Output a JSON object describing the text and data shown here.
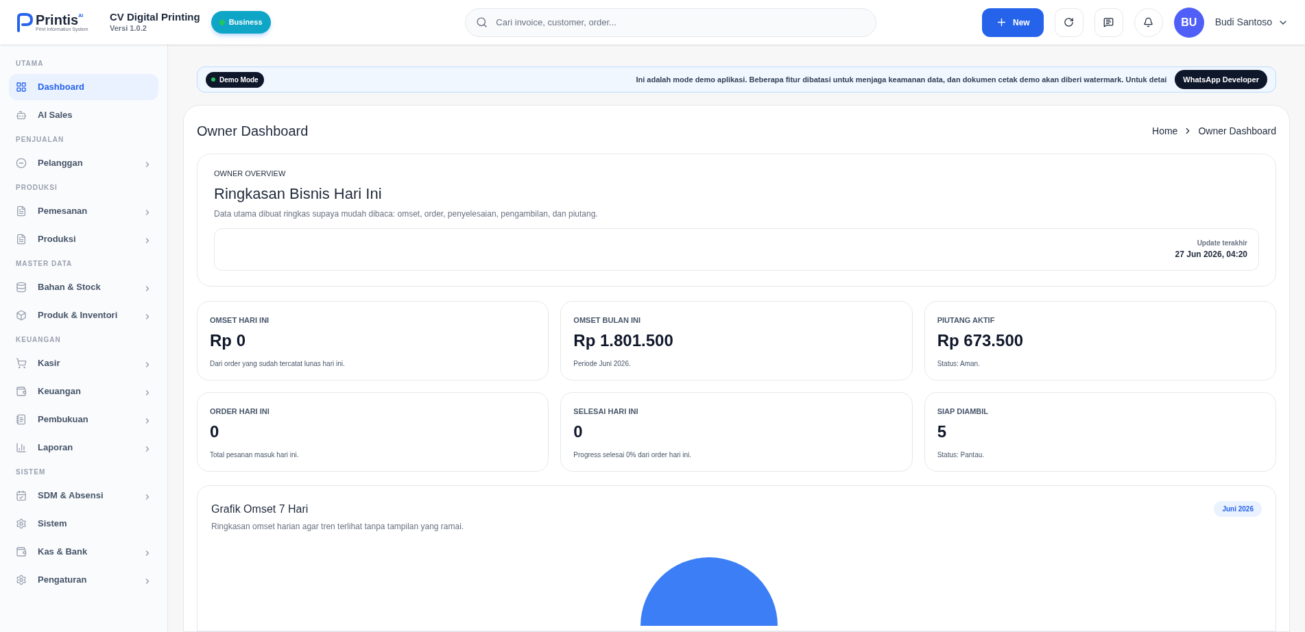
{
  "header": {
    "logo": {
      "name": "Printis",
      "superscript": "AI",
      "tagline": "Print Information System"
    },
    "company": "CV Digital Printing",
    "version": "Versi 1.0.2",
    "plan_badge": "Business",
    "search": {
      "placeholder": "Cari invoice, customer, order..."
    },
    "new_button": "New",
    "user": {
      "initials": "BU",
      "name": "Budi Santoso"
    }
  },
  "sidebar": [
    {
      "title": "UTAMA",
      "items": [
        {
          "label": "Dashboard",
          "selected": true,
          "has_submenu": false
        },
        {
          "label": "AI Sales",
          "selected": false,
          "has_submenu": false
        }
      ]
    },
    {
      "title": "PENJUALAN",
      "items": [
        {
          "label": "Pelanggan",
          "selected": false,
          "has_submenu": true
        }
      ]
    },
    {
      "title": "PRODUKSI",
      "items": [
        {
          "label": "Pemesanan",
          "selected": false,
          "has_submenu": true
        },
        {
          "label": "Produksi",
          "selected": false,
          "has_submenu": true
        }
      ]
    },
    {
      "title": "MASTER DATA",
      "items": [
        {
          "label": "Bahan & Stock",
          "selected": false,
          "has_submenu": true
        },
        {
          "label": "Produk & Inventori",
          "selected": false,
          "has_submenu": true
        }
      ]
    },
    {
      "title": "KEUANGAN",
      "items": [
        {
          "label": "Kasir",
          "selected": false,
          "has_submenu": true
        },
        {
          "label": "Keuangan",
          "selected": false,
          "has_submenu": true
        },
        {
          "label": "Pembukuan",
          "selected": false,
          "has_submenu": true
        },
        {
          "label": "Laporan",
          "selected": false,
          "has_submenu": true
        }
      ]
    },
    {
      "title": "SISTEM",
      "items": [
        {
          "label": "SDM & Absensi",
          "selected": false,
          "has_submenu": true
        },
        {
          "label": "Sistem",
          "selected": false,
          "has_submenu": false
        },
        {
          "label": "Kas & Bank",
          "selected": false,
          "has_submenu": true
        },
        {
          "label": "Pengaturan",
          "selected": false,
          "has_submenu": true
        }
      ]
    }
  ],
  "demo_banner": {
    "badge": "Demo Mode",
    "message": "Ini adalah mode demo aplikasi. Beberapa fitur dibatasi untuk menjaga keamanan data, dan dokumen cetak demo akan diberi watermark. Untuk detai",
    "button": "WhatsApp Developer"
  },
  "page": {
    "title": "Owner Dashboard",
    "breadcrumb": [
      "Home",
      "Owner Dashboard"
    ]
  },
  "overview": {
    "eyebrow": "OWNER OVERVIEW",
    "title": "Ringkasan Bisnis Hari Ini",
    "description": "Data utama dibuat ringkas supaya mudah dibaca: omset, order, penyelesaian, pengambilan, dan piutang.",
    "update_label": "Update terakhir",
    "update_value": "27 Jun 2026, 04:20"
  },
  "stats": [
    {
      "label": "OMSET HARI INI",
      "value": "Rp 0",
      "note": "Dari order yang sudah tercatat lunas hari ini."
    },
    {
      "label": "OMSET BULAN INI",
      "value": "Rp 1.801.500",
      "note": "Periode Juni 2026."
    },
    {
      "label": "PIUTANG AKTIF",
      "value": "Rp 673.500",
      "note": "Status: Aman."
    },
    {
      "label": "ORDER HARI INI",
      "value": "0",
      "note": "Total pesanan masuk hari ini."
    },
    {
      "label": "SELESAI HARI INI",
      "value": "0",
      "note": "Progress selesai 0% dari order hari ini."
    },
    {
      "label": "SIAP DIAMBIL",
      "value": "5",
      "note": "Status: Pantau."
    }
  ],
  "chart_card": {
    "title": "Grafik Omset 7 Hari",
    "subtitle": "Ringkasan omset harian agar tren terlihat tanpa tampilan yang ramai.",
    "period_badge": "Juni 2026"
  }
}
